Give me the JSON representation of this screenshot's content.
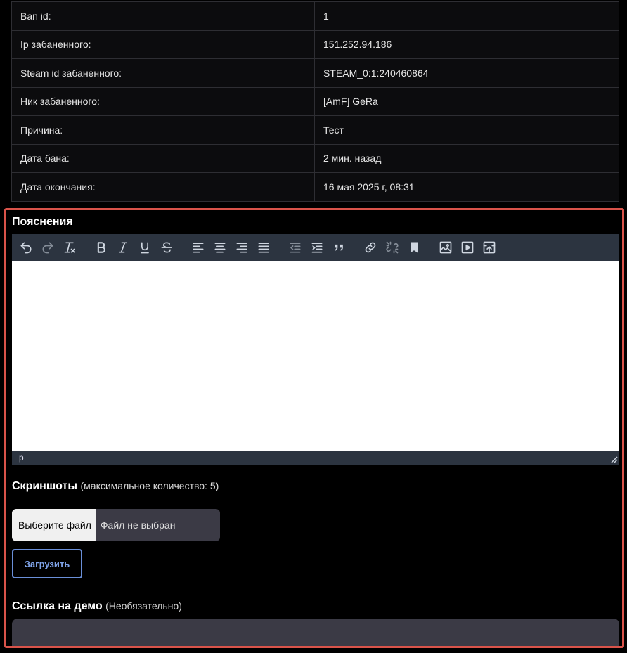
{
  "ban_info": {
    "rows": [
      {
        "key": "Ban id:",
        "value": "1"
      },
      {
        "key": "Ip забаненного:",
        "value": "151.252.94.186"
      },
      {
        "key": "Steam id забаненного:",
        "value": "STEAM_0:1:240460864"
      },
      {
        "key": "Ник забаненного:",
        "value": "[AmF] GeRa"
      },
      {
        "key": "Причина:",
        "value": "Тест"
      },
      {
        "key": "Дата бана:",
        "value": "2 мин. назад"
      },
      {
        "key": "Дата окончания:",
        "value": "16 мая 2025 г, 08:31"
      }
    ]
  },
  "explanations": {
    "title": "Пояснения",
    "toolbar_icons": [
      "undo-icon",
      "redo-icon",
      "clear-formatting-icon",
      "bold-icon",
      "italic-icon",
      "underline-icon",
      "strikethrough-icon",
      "align-left-icon",
      "align-center-icon",
      "align-right-icon",
      "align-justify-icon",
      "outdent-icon",
      "indent-icon",
      "blockquote-icon",
      "link-icon",
      "unlink-icon",
      "bookmark-icon",
      "image-icon",
      "media-icon",
      "upload-icon"
    ],
    "statusbar_path": "p"
  },
  "screenshots": {
    "title": "Скриншоты",
    "hint": "(максимальное количество: 5)",
    "choose_file_label": "Выберите файл",
    "file_status": "Файл не выбран",
    "upload_label": "Загрузить"
  },
  "demo": {
    "title": "Ссылка на демо",
    "hint": "(Необязательно)",
    "value": ""
  },
  "colors": {
    "panel_border": "#d9534a",
    "toolbar_bg": "#2c3440",
    "input_bg": "#3b3a45",
    "upload_accent": "#6a8fd8"
  }
}
